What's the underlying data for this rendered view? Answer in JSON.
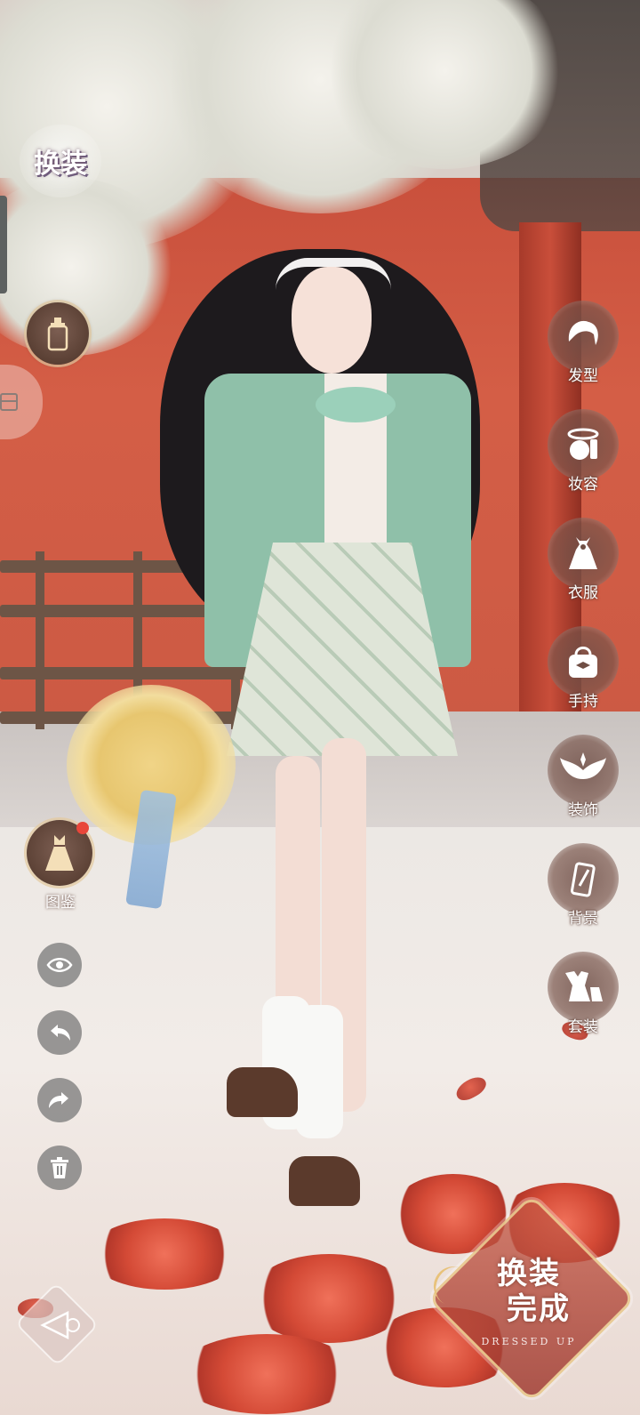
{
  "header": {
    "title": "换装"
  },
  "right_menu": [
    {
      "label": "发型",
      "icon": "hairstyle-icon"
    },
    {
      "label": "妆容",
      "icon": "makeup-icon"
    },
    {
      "label": "衣服",
      "icon": "dress-icon"
    },
    {
      "label": "手持",
      "icon": "handbag-icon"
    },
    {
      "label": "装饰",
      "icon": "wings-icon"
    },
    {
      "label": "背景",
      "icon": "background-icon"
    },
    {
      "label": "套装",
      "icon": "outfit-set-icon"
    }
  ],
  "left_tools": {
    "skincare_icon": "lotion-bottle-icon",
    "codex": {
      "label": "图鉴",
      "icon": "gown-icon",
      "has_notification": true
    },
    "buttons": [
      {
        "name": "toggle-visibility-button",
        "icon": "eye-icon"
      },
      {
        "name": "undo-button",
        "icon": "undo-icon"
      },
      {
        "name": "redo-button",
        "icon": "redo-icon"
      },
      {
        "name": "delete-button",
        "icon": "trash-icon"
      }
    ]
  },
  "done_button": {
    "line1": "换装",
    "line2": "完成",
    "subtitle": "DRESSED UP"
  },
  "colors": {
    "wall_red": "#cc5a44",
    "menu_brown": "#6f4e44",
    "gold_rim": "#e3c9a0",
    "jacket_green": "#8fc0a9"
  }
}
